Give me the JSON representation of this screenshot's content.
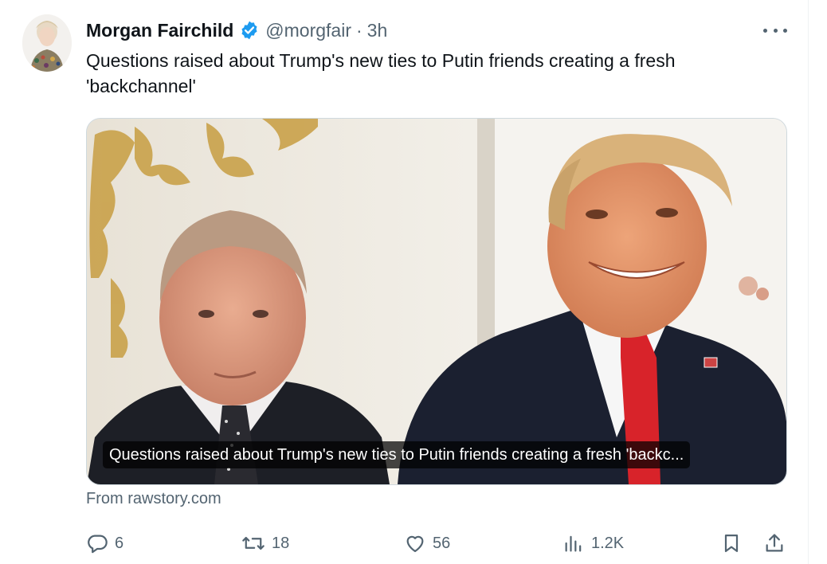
{
  "tweet": {
    "author_name": "Morgan Fairchild",
    "handle": "@morgfair",
    "separator": "·",
    "time": "3h",
    "text": "Questions raised about Trump's new ties to Putin friends creating a fresh 'backchannel'"
  },
  "card": {
    "caption": "Questions raised about Trump's new ties to Putin friends creating a fresh 'backc...",
    "source": "From rawstory.com"
  },
  "actions": {
    "replies": "6",
    "reposts": "18",
    "likes": "56",
    "views": "1.2K"
  },
  "colors": {
    "verified": "#1d9bf0",
    "secondary_text": "#536471",
    "tie_red": "#d8232a"
  },
  "icons": [
    "avatar",
    "verified-badge-icon",
    "more-options-icon",
    "reply-icon",
    "repost-icon",
    "like-icon",
    "views-icon",
    "bookmark-icon",
    "share-icon"
  ]
}
